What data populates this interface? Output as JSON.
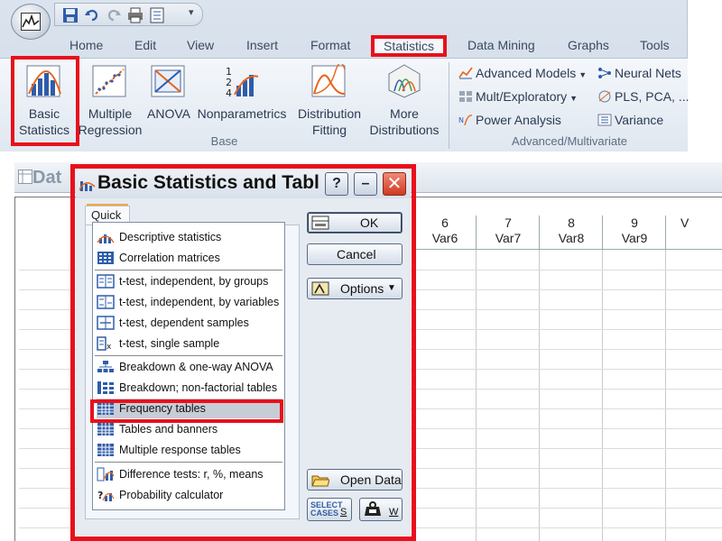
{
  "ribbon": {
    "tabs": [
      "Home",
      "Edit",
      "View",
      "Insert",
      "Format",
      "Statistics",
      "Data Mining",
      "Graphs",
      "Tools"
    ],
    "active_tab": "Statistics",
    "base_buttons": [
      {
        "line1": "Basic",
        "line2": "Statistics",
        "icon": "basic-statistics-icon"
      },
      {
        "line1": "Multiple",
        "line2": "Regression",
        "icon": "multiple-regression-icon"
      },
      {
        "line1": "ANOVA",
        "line2": "",
        "icon": "anova-icon"
      },
      {
        "line1": "Nonparametrics",
        "line2": "",
        "icon": "nonparametrics-icon"
      },
      {
        "line1": "Distribution",
        "line2": "Fitting",
        "icon": "distribution-fitting-icon"
      },
      {
        "line1": "More",
        "line2": "Distributions",
        "icon": "more-distributions-icon"
      }
    ],
    "base_group_label": "Base",
    "advanced": {
      "advanced_models": "Advanced Models",
      "neural_nets": "Neural Nets",
      "mult_exploratory": "Mult/Exploratory",
      "pls_pca": "PLS, PCA, ...",
      "power_analysis": "Power Analysis",
      "variance": "Variance",
      "group_label": "Advanced/Multivariate"
    }
  },
  "sheet": {
    "title": "Dat",
    "columns": [
      {
        "num": "6",
        "name": "Var6"
      },
      {
        "num": "7",
        "name": "Var7"
      },
      {
        "num": "8",
        "name": "Var8"
      },
      {
        "num": "9",
        "name": "Var9"
      },
      {
        "num": "",
        "name": "V"
      }
    ]
  },
  "dialog": {
    "title": "Basic Statistics and Tabl",
    "help_label": "?",
    "minimize_label": "–",
    "close_label": "✕",
    "tab": "Quick",
    "items": [
      {
        "label": "Descriptive statistics",
        "icon": "descriptive-statistics-icon"
      },
      {
        "label": "Correlation matrices",
        "icon": "correlation-matrices-icon"
      },
      {
        "label": "t-test, independent, by groups",
        "icon": "ttest-groups-icon"
      },
      {
        "label": "t-test, independent, by variables",
        "icon": "ttest-variables-icon"
      },
      {
        "label": "t-test, dependent samples",
        "icon": "ttest-dependent-icon"
      },
      {
        "label": "t-test, single sample",
        "icon": "ttest-single-icon"
      },
      {
        "label": "Breakdown & one-way ANOVA",
        "icon": "breakdown-anova-icon"
      },
      {
        "label": "Breakdown; non-factorial tables",
        "icon": "breakdown-nonfactorial-icon"
      },
      {
        "label": "Frequency tables",
        "icon": "frequency-tables-icon"
      },
      {
        "label": "Tables and banners",
        "icon": "tables-banners-icon"
      },
      {
        "label": "Multiple response tables",
        "icon": "multiple-response-icon"
      },
      {
        "label": "Difference tests: r, %, means",
        "icon": "difference-tests-icon"
      },
      {
        "label": "Probability calculator",
        "icon": "probability-calculator-icon"
      }
    ],
    "selected_item": "Frequency tables",
    "buttons": {
      "ok": "OK",
      "cancel": "Cancel",
      "options": "Options",
      "open_data": "Open Data",
      "select_cases_line1": "SELECT",
      "select_cases_line2": "CASES",
      "select_cases_key": "S",
      "weight_key": "W"
    }
  },
  "colors": {
    "highlight": "#e8101c",
    "ribbon_text": "#2b3a52",
    "selection": "#c7cdd6"
  }
}
